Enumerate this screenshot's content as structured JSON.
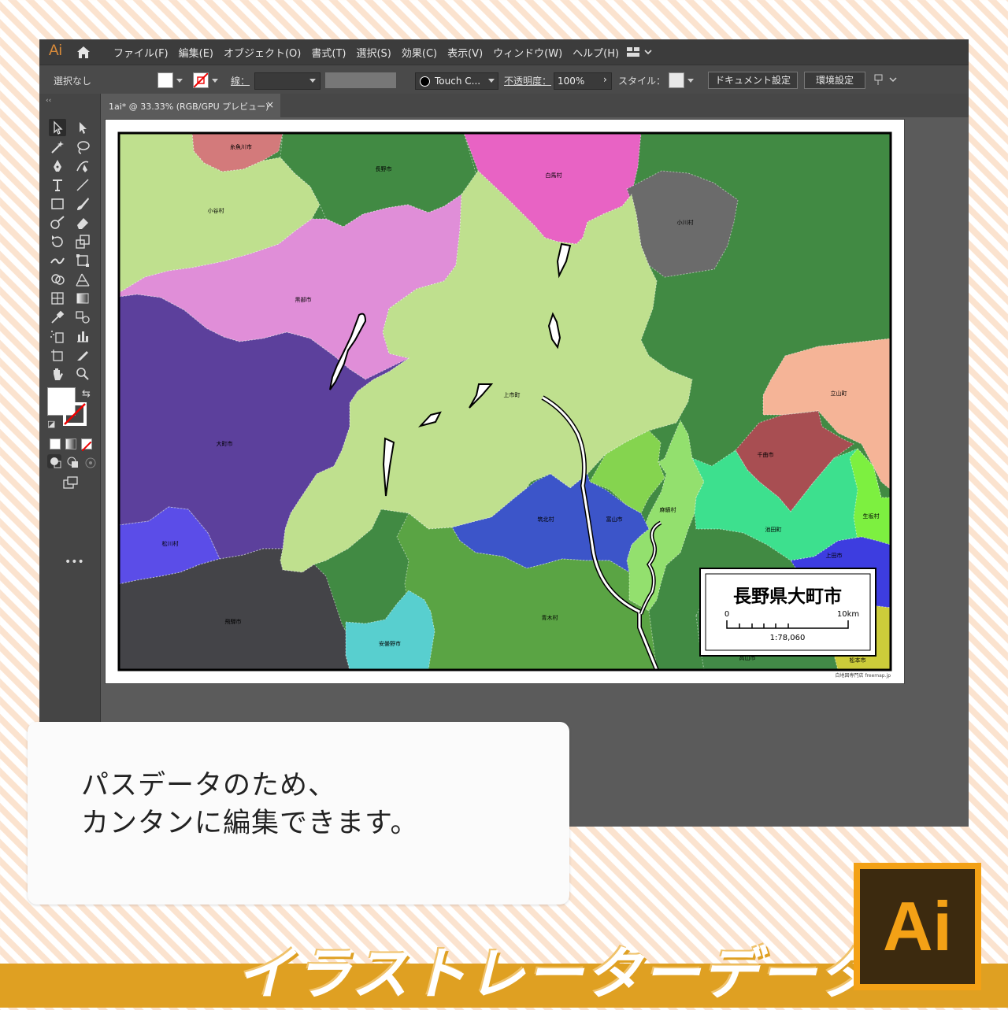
{
  "app": {
    "logo": "Ai",
    "menu": [
      "ファイル(F)",
      "編集(E)",
      "オブジェクト(O)",
      "書式(T)",
      "選択(S)",
      "効果(C)",
      "表示(V)",
      "ウィンドウ(W)",
      "ヘルプ(H)"
    ]
  },
  "control_bar": {
    "selection": "選択なし",
    "stroke_label": "線：",
    "brush": "Touch C...",
    "opacity_label": "不透明度：",
    "opacity_value": "100%",
    "style_label": "スタイル：",
    "doc_settings": "ドキュメント設定",
    "preferences": "環境設定"
  },
  "tab": {
    "title": "1ai* @ 33.33% (RGB/GPU プレビュー)",
    "close": "×"
  },
  "map": {
    "regions": [
      {
        "name": "糸魚川市",
        "color": "#d37a7b"
      },
      {
        "name": "小谷村",
        "color": "#bfe08e"
      },
      {
        "name": "白馬村",
        "color": "#e863c4"
      },
      {
        "name": "小川村",
        "color": "#6b6b6b"
      },
      {
        "name": "長野市",
        "color": "#418a43"
      },
      {
        "name": "黒部市",
        "color": "#e08ed8"
      },
      {
        "name": "上市町",
        "color": "#bfe08e"
      },
      {
        "name": "立山町",
        "color": "#f5b497"
      },
      {
        "name": "大町市",
        "color": "#5c409c"
      },
      {
        "name": "千曲市",
        "color": "#a84e52"
      },
      {
        "name": "富山市",
        "color": "#85d44f"
      },
      {
        "name": "麻績村",
        "color": "#93e06e"
      },
      {
        "name": "池田町",
        "color": "#3de08e"
      },
      {
        "name": "生坂村",
        "color": "#7df040"
      },
      {
        "name": "筑北村",
        "color": "#3c55c9"
      },
      {
        "name": "上田市",
        "color": "#3d3de0"
      },
      {
        "name": "松川村",
        "color": "#5b4de8"
      },
      {
        "name": "青木村",
        "color": "#5aa444"
      },
      {
        "name": "飛騨市",
        "color": "#444448"
      },
      {
        "name": "安曇野市",
        "color": "#58cfcf"
      },
      {
        "name": "高山市",
        "color": "#428a47"
      },
      {
        "name": "松本市",
        "color": "#cccc3a"
      },
      {
        "name": "松本市",
        "color": "#b0e66a"
      },
      {
        "name": "上田市",
        "color": "#4850c4"
      }
    ],
    "title": "長野県大町市",
    "scale_left": "0",
    "scale_right": "10km",
    "scale_ratio": "1:78,060",
    "credit": "白地図専門店 freemap.jp"
  },
  "overlay": {
    "line1": "パスデータのため、",
    "line2": "カンタンに編集できます。"
  },
  "banner": "イラストレーターデータ",
  "logo_badge": "Ai",
  "colors": {
    "accent": "#dfa022",
    "ui_dark": "#3c3c3c",
    "ui_canvas": "#5b5b5b",
    "stripe": "#fbe3cf"
  }
}
